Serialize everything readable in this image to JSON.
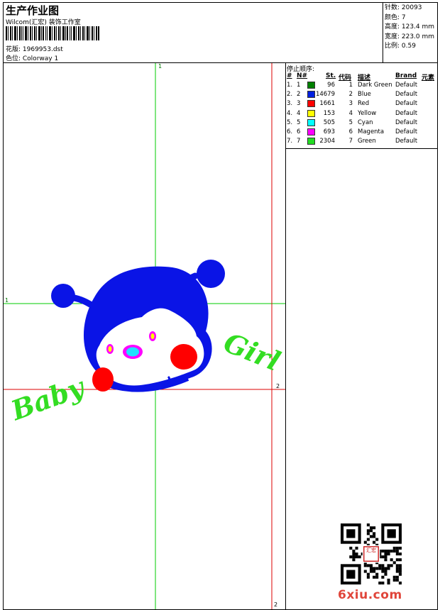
{
  "header": {
    "title": "生产作业图",
    "company": "Wilcom(汇宏) 装饰工作室",
    "design_label": "花版: 1969953.dst",
    "colorway_label": "色位:  Colorway 1"
  },
  "stats": {
    "stitches": "针数: 20093",
    "colors": "颜色: 7",
    "height": "高度: 123.4 mm",
    "width": "宽度: 223.0 mm",
    "scale": "比例: 0.59"
  },
  "sequence": {
    "title": "停止顺序:",
    "headers": {
      "num": "#",
      "n": "N#",
      "st": "St.",
      "code": "代码",
      "desc": "描述",
      "brand": "Brand",
      "element": "元素"
    },
    "rows": [
      {
        "num": "1.",
        "n": "1",
        "color": "#008000",
        "st": "96",
        "code": "1",
        "desc": "Dark Green",
        "brand": "Default"
      },
      {
        "num": "2.",
        "n": "2",
        "color": "#0020e0",
        "st": "14679",
        "code": "2",
        "desc": "Blue",
        "brand": "Default"
      },
      {
        "num": "3.",
        "n": "3",
        "color": "#ff0000",
        "st": "1661",
        "code": "3",
        "desc": "Red",
        "brand": "Default"
      },
      {
        "num": "4.",
        "n": "4",
        "color": "#ffff00",
        "st": "153",
        "code": "4",
        "desc": "Yellow",
        "brand": "Default"
      },
      {
        "num": "5.",
        "n": "5",
        "color": "#00ffff",
        "st": "505",
        "code": "5",
        "desc": "Cyan",
        "brand": "Default"
      },
      {
        "num": "6.",
        "n": "6",
        "color": "#ff00ff",
        "st": "693",
        "code": "6",
        "desc": "Magenta",
        "brand": "Default"
      },
      {
        "num": "7.",
        "n": "7",
        "color": "#22dd22",
        "st": "2304",
        "code": "7",
        "desc": "Green",
        "brand": "Default"
      }
    ]
  },
  "design": {
    "text_left": "Baby",
    "text_right": "Girl",
    "guide_labels": {
      "top": "1",
      "left": "1",
      "right": "2",
      "bottom": "2"
    },
    "colors": {
      "blue": "#0a14e6",
      "red": "#ff0000",
      "cyan": "#20e0ff",
      "magenta": "#ff00ff",
      "green": "#33dd22",
      "guide_green": "#00cc00",
      "guide_red": "#dd0000"
    }
  },
  "watermark": {
    "site": "6xiu.com",
    "seal_text": "汇宏"
  }
}
